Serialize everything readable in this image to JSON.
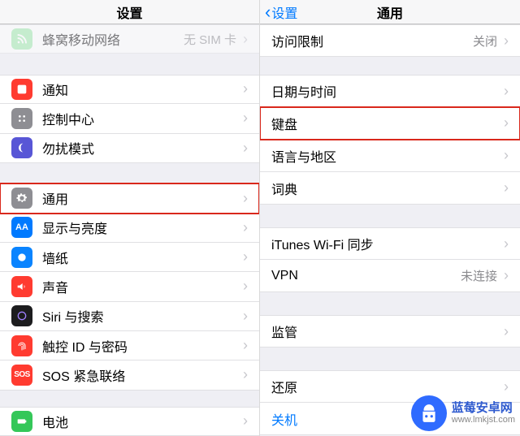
{
  "left": {
    "title": "设置",
    "rows": {
      "cellular": {
        "label": "蜂窝移动网络",
        "value": "无 SIM 卡"
      },
      "notifications": {
        "label": "通知"
      },
      "controlCenter": {
        "label": "控制中心"
      },
      "dnd": {
        "label": "勿扰模式"
      },
      "general": {
        "label": "通用"
      },
      "display": {
        "label": "显示与亮度"
      },
      "wallpaper": {
        "label": "墙纸"
      },
      "sound": {
        "label": "声音"
      },
      "siri": {
        "label": "Siri 与搜索"
      },
      "touchid": {
        "label": "触控 ID 与密码"
      },
      "sos": {
        "label": "SOS 紧急联络",
        "badge": "SOS"
      },
      "battery": {
        "label": "电池"
      }
    }
  },
  "right": {
    "back": "设置",
    "title": "通用",
    "rows": {
      "restrictions": {
        "label": "访问限制",
        "value": "关闭"
      },
      "datetime": {
        "label": "日期与时间"
      },
      "keyboard": {
        "label": "键盘"
      },
      "language": {
        "label": "语言与地区"
      },
      "dictionary": {
        "label": "词典"
      },
      "itunes": {
        "label": "iTunes Wi-Fi 同步"
      },
      "vpn": {
        "label": "VPN",
        "value": "未连接"
      },
      "regulatory": {
        "label": "监管"
      },
      "reset": {
        "label": "还原"
      },
      "shutdown": {
        "label": "关机"
      }
    }
  },
  "watermark": {
    "name": "蓝莓安卓网",
    "url": "www.lmkjst.com"
  }
}
